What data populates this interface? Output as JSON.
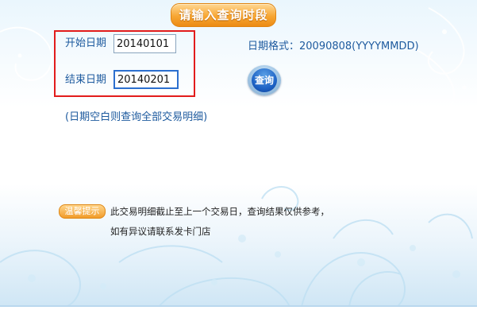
{
  "title": "请输入查询时段",
  "form": {
    "start_label": "开始日期",
    "start_value": "20140101",
    "end_label": "结束日期",
    "end_value": "20140201",
    "format_hint": "日期格式：20090808(YYYYMMDD)",
    "query_button": "查询",
    "empty_hint": "(日期空白则查询全部交易明细)"
  },
  "tip": {
    "badge": "温馨提示",
    "line1": "此交易明细截止至上一个交易日，查询结果仅供参考，",
    "line2": "如有异议请联系发卡门店"
  },
  "colors": {
    "accent_orange": "#f19c2a",
    "link_blue": "#1d5a9e",
    "highlight_red": "#e21c1c"
  }
}
